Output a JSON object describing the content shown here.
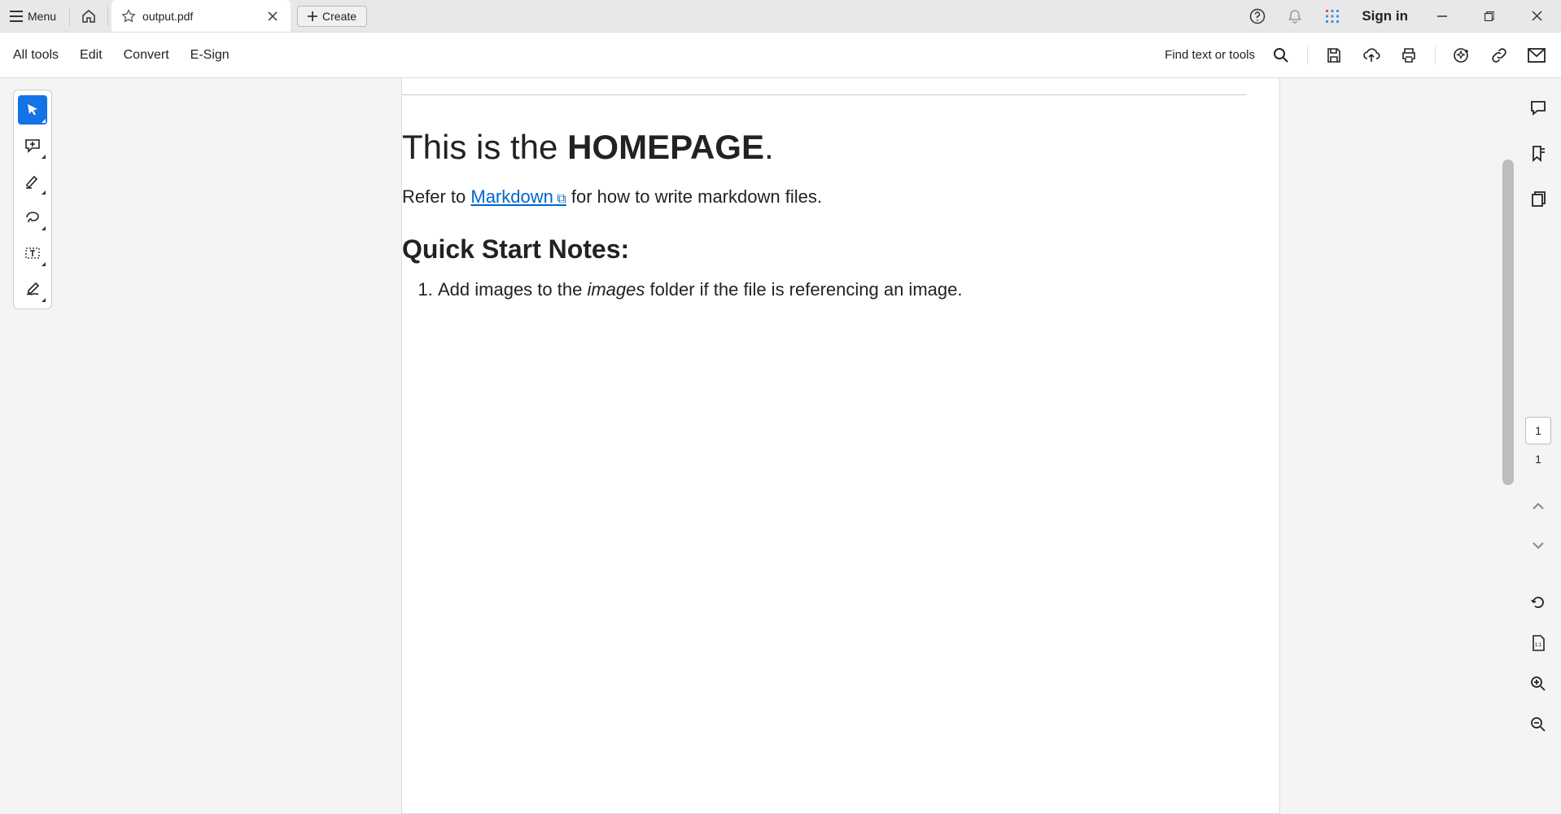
{
  "titlebar": {
    "menu_label": "Menu",
    "tab_title": "output.pdf",
    "create_label": "Create",
    "signin_label": "Sign in"
  },
  "toolbar": {
    "all_tools": "All tools",
    "edit": "Edit",
    "convert": "Convert",
    "esign": "E-Sign",
    "find_label": "Find text or tools"
  },
  "document": {
    "h1_pre": "This is the ",
    "h1_bold": "HOMEPAGE",
    "h1_post": ".",
    "p1_pre": "Refer to ",
    "p1_link": "Markdown",
    "p1_post": " for how to write markdown files.",
    "h2": "Quick Start Notes:",
    "li1_pre": "Add images to the ",
    "li1_italic": "images",
    "li1_post": " folder if the file is referencing an image."
  },
  "page_nav": {
    "current": "1",
    "total": "1"
  }
}
